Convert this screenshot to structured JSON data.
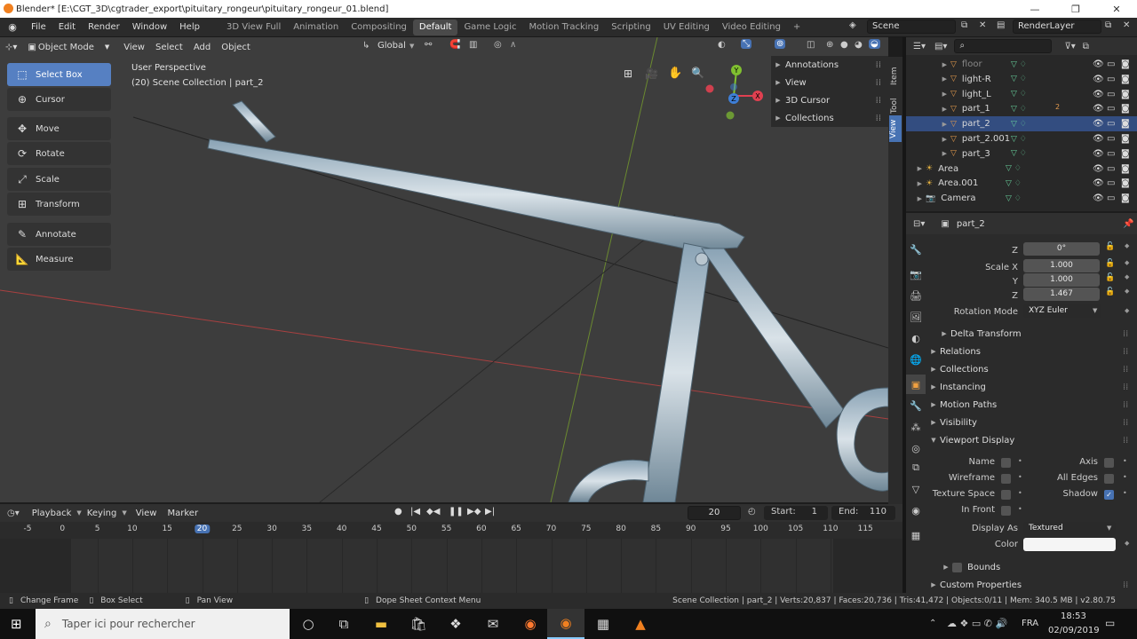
{
  "window": {
    "title": "Blender* [E:\\CGT_3D\\cgtrader_export\\pituitary_rongeur\\pituitary_rongeur_01.blend]",
    "minimize": "—",
    "maximize": "❐",
    "close": "✕"
  },
  "menus": [
    "File",
    "Edit",
    "Render",
    "Window",
    "Help"
  ],
  "workspaces": [
    "3D View Full",
    "Animation",
    "Compositing",
    "Default",
    "Game Logic",
    "Motion Tracking",
    "Scripting",
    "UV Editing",
    "Video Editing"
  ],
  "workspace_active": "Default",
  "scene": "Scene",
  "render_layer": "RenderLayer",
  "viewport": {
    "mode": "Object Mode",
    "menus": [
      "View",
      "Select",
      "Add",
      "Object"
    ],
    "orientation": "Global",
    "overlay_text_1": "User Perspective",
    "overlay_text_2": "(20) Scene Collection | part_2"
  },
  "tools": [
    {
      "label": "Select Box",
      "icon": "select-box-icon",
      "glyph": "⬚"
    },
    {
      "label": "Cursor",
      "icon": "cursor-icon",
      "glyph": "⊕"
    },
    {
      "label": "Move",
      "icon": "move-icon",
      "glyph": "✥"
    },
    {
      "label": "Rotate",
      "icon": "rotate-icon",
      "glyph": "⟳"
    },
    {
      "label": "Scale",
      "icon": "scale-icon",
      "glyph": "⤢"
    },
    {
      "label": "Transform",
      "icon": "transform-icon",
      "glyph": "⊞"
    },
    {
      "label": "Annotate",
      "icon": "annotate-icon",
      "glyph": "✎"
    },
    {
      "label": "Measure",
      "icon": "measure-icon",
      "glyph": "📐"
    }
  ],
  "npanel": [
    "Annotations",
    "View",
    "3D Cursor",
    "Collections"
  ],
  "npanel_tabs": [
    "Item",
    "Tool",
    "View"
  ],
  "gizmo": {
    "x": "X",
    "y": "Y",
    "z": "Z"
  },
  "outliner": {
    "rows": [
      {
        "name": "floor",
        "dim": true
      },
      {
        "name": "light-R"
      },
      {
        "name": "light_L"
      },
      {
        "name": "part_1",
        "badge": "2"
      },
      {
        "name": "part_2",
        "selected": true
      },
      {
        "name": "part_2.001"
      },
      {
        "name": "part_3"
      },
      {
        "name": "Area"
      },
      {
        "name": "Area.001"
      },
      {
        "name": "Camera"
      }
    ]
  },
  "properties": {
    "object": "part_2",
    "transform": [
      {
        "label": "Z",
        "value": "0°"
      },
      {
        "label": "Scale X",
        "value": "1.000"
      },
      {
        "label": "Y",
        "value": "1.000"
      },
      {
        "label": "Z",
        "value": "1.467"
      }
    ],
    "rotation_mode_label": "Rotation Mode",
    "rotation_mode": "XYZ Euler",
    "delta": "Delta Transform",
    "sections": [
      "Relations",
      "Collections",
      "Instancing",
      "Motion Paths",
      "Visibility"
    ],
    "viewport_display": "Viewport Display",
    "vd_left": [
      {
        "label": "Name",
        "on": false
      },
      {
        "label": "Wireframe",
        "on": false
      },
      {
        "label": "Texture Space",
        "on": false
      },
      {
        "label": "In Front",
        "on": false
      }
    ],
    "vd_right": [
      {
        "label": "Axis",
        "on": false
      },
      {
        "label": "All Edges",
        "on": false
      },
      {
        "label": "Shadow",
        "on": true
      }
    ],
    "display_as_label": "Display As",
    "display_as": "Textured",
    "color_label": "Color",
    "bounds": "Bounds",
    "custom": "Custom Properties"
  },
  "timeline": {
    "menus": [
      "Playback",
      "Keying",
      "View",
      "Marker"
    ],
    "frame": "20",
    "start_label": "Start:",
    "start": "1",
    "end_label": "End:",
    "end": "110",
    "ticks": [
      "-5",
      "0",
      "5",
      "10",
      "15",
      "20",
      "25",
      "30",
      "35",
      "40",
      "45",
      "50",
      "55",
      "60",
      "65",
      "70",
      "75",
      "80",
      "85",
      "90",
      "95",
      "100",
      "105",
      "110",
      "115"
    ],
    "current": "20"
  },
  "status": {
    "a": "Change Frame",
    "b": "Box Select",
    "c": "Pan View",
    "d": "Dope Sheet Context Menu",
    "stats": "Scene Collection | part_2 | Verts:20,837 | Faces:20,736 | Tris:41,472 | Objects:0/11 | Mem: 340.5 MB | v2.80.75"
  },
  "taskbar": {
    "search": "Taper ici pour rechercher",
    "lang": "FRA",
    "time": "18:53",
    "date": "02/09/2019"
  },
  "colors": {
    "accent": "#5680c2",
    "x_axis": "#e04050",
    "y_axis": "#80c030",
    "z_axis": "#3e7fd8"
  }
}
